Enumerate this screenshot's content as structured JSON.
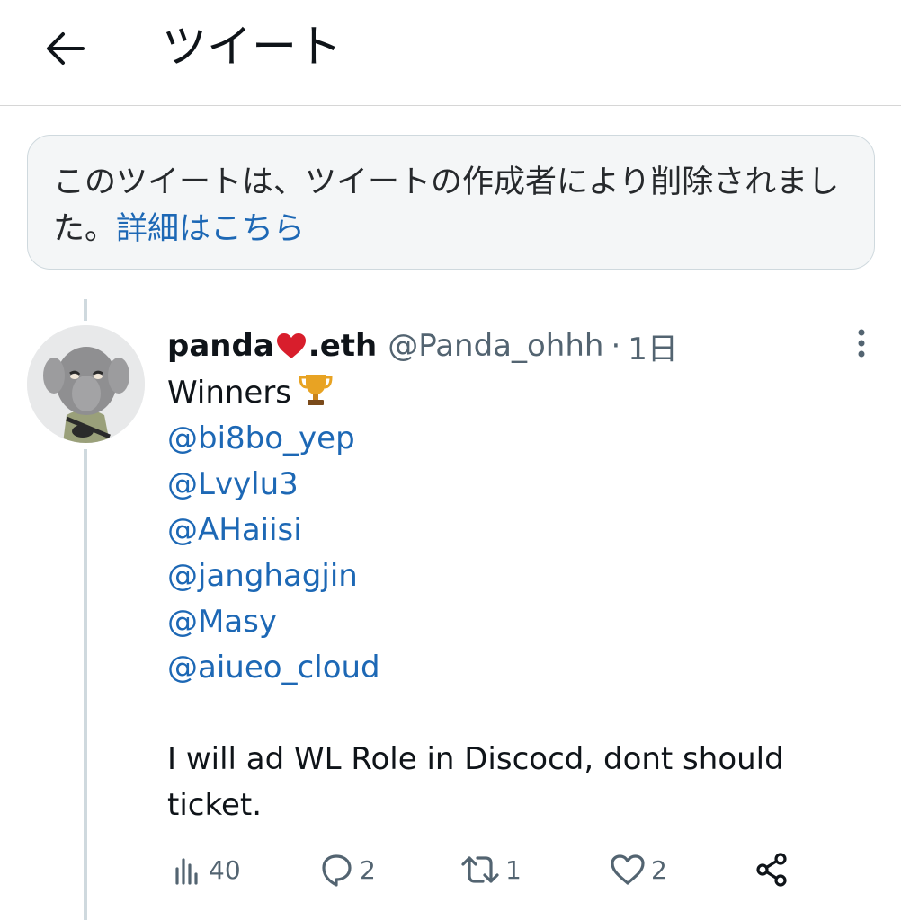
{
  "header": {
    "title": "ツイート"
  },
  "deleted_notice": {
    "text": "このツイートは、ツイートの作成者により削除されました。",
    "link": "詳細はこちら"
  },
  "tweet": {
    "display_name_part1": "panda",
    "display_name_part2": ".eth",
    "handle": "@Panda_ohhh",
    "separator": "·",
    "time": "1日",
    "first_line": "Winners",
    "mentions": [
      "@bi8bo_yep",
      "@Lvylu3",
      "@AHaiisi",
      "@janghagjin",
      "@Masy",
      "@aiueo_cloud"
    ],
    "body_line1": "I will ad WL Role in Discocd, dont should",
    "body_line2": "ticket."
  },
  "actions": {
    "views": "40",
    "replies": "2",
    "retweets": "1",
    "likes": "2"
  },
  "colors": {
    "link": "#1d68b5",
    "secondary_text": "#536471",
    "heart": "#d81e2c"
  },
  "icons": {
    "back": "arrow-left-icon",
    "more": "more-vertical-icon",
    "views": "bar-chart-icon",
    "reply": "reply-icon",
    "retweet": "retweet-icon",
    "like": "heart-outline-icon",
    "share": "share-icon"
  }
}
